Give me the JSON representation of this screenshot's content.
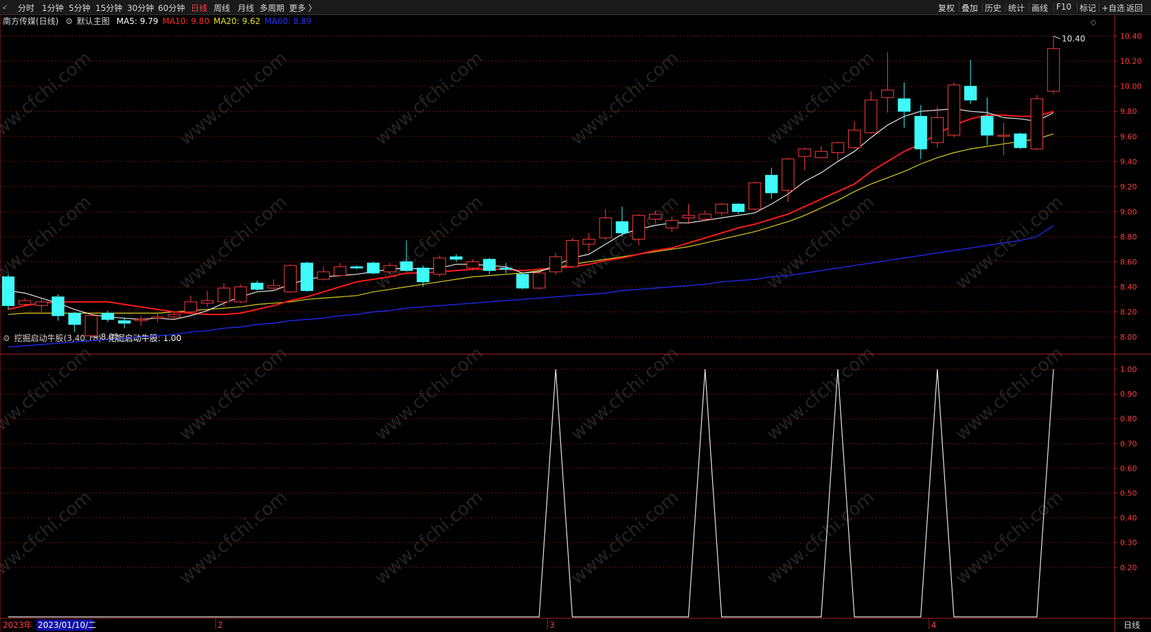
{
  "toolbar": {
    "periods": [
      "分时",
      "1分钟",
      "5分钟",
      "15分钟",
      "30分钟",
      "60分钟",
      "日线",
      "周线",
      "月线",
      "多周期",
      "更多 〉"
    ],
    "active_index": 6,
    "right_buttons": [
      "复权",
      "叠加",
      "历史",
      "统计",
      "画线",
      "F10",
      "标记",
      "+自选",
      "返回"
    ]
  },
  "main_panel": {
    "stock_title": "南方传媒(日线)",
    "template": "默认主图",
    "ma": [
      {
        "label": "MA5: 9.79",
        "color": "#ffffff"
      },
      {
        "label": "MA10: 9.80",
        "color": "#ff2a2a"
      },
      {
        "label": "MA20: 9.62",
        "color": "#e8e020"
      },
      {
        "label": "MA60: 8.89",
        "color": "#2430ff"
      }
    ],
    "high_label": "10.40",
    "low_label": "8.01",
    "y_ticks": [
      "10.40",
      "10.20",
      "10.00",
      "9.80",
      "9.60",
      "9.40",
      "9.20",
      "9.00",
      "8.80",
      "8.60",
      "8.40",
      "8.20",
      "8.00"
    ]
  },
  "indicator_panel": {
    "title": "挖掘启动牛股(3,40,18)",
    "value_label": "挖掘启动牛股: 1.00",
    "y_ticks": [
      "1.00",
      "0.90",
      "0.80",
      "0.70",
      "0.60",
      "0.50",
      "0.40",
      "0.30",
      "0.20"
    ]
  },
  "bottom_bar": {
    "year": "2023年",
    "date": "2023/01/10/二",
    "months": [
      "2",
      "3",
      "4"
    ],
    "period": "日线"
  },
  "watermark": "www.cfchi.com",
  "chart_data": {
    "type": "candlestick",
    "y_range": [
      7.88,
      10.48
    ],
    "candles": [
      {
        "o": 8.48,
        "c": 8.25,
        "h": 8.5,
        "l": 8.22
      },
      {
        "o": 8.26,
        "c": 8.29,
        "h": 8.31,
        "l": 8.25
      },
      {
        "o": 8.25,
        "c": 8.28,
        "h": 8.31,
        "l": 8.2
      },
      {
        "o": 8.32,
        "c": 8.17,
        "h": 8.34,
        "l": 8.13
      },
      {
        "o": 8.19,
        "c": 8.1,
        "h": 8.2,
        "l": 8.04
      },
      {
        "o": 8.01,
        "c": 8.17,
        "h": 8.19,
        "l": 8.0
      },
      {
        "o": 8.19,
        "c": 8.14,
        "h": 8.21,
        "l": 8.12
      },
      {
        "o": 8.13,
        "c": 8.11,
        "h": 8.15,
        "l": 8.07
      },
      {
        "o": 8.13,
        "c": 8.14,
        "h": 8.17,
        "l": 8.09
      },
      {
        "o": 8.15,
        "c": 8.16,
        "h": 8.19,
        "l": 8.12
      },
      {
        "o": 8.16,
        "c": 8.18,
        "h": 8.2,
        "l": 8.14
      },
      {
        "o": 8.2,
        "c": 8.28,
        "h": 8.33,
        "l": 8.18
      },
      {
        "o": 8.27,
        "c": 8.29,
        "h": 8.37,
        "l": 8.24
      },
      {
        "o": 8.28,
        "c": 8.39,
        "h": 8.43,
        "l": 8.24
      },
      {
        "o": 8.28,
        "c": 8.4,
        "h": 8.42,
        "l": 8.27
      },
      {
        "o": 8.43,
        "c": 8.38,
        "h": 8.45,
        "l": 8.37
      },
      {
        "o": 8.39,
        "c": 8.41,
        "h": 8.46,
        "l": 8.37
      },
      {
        "o": 8.36,
        "c": 8.57,
        "h": 8.58,
        "l": 8.35
      },
      {
        "o": 8.59,
        "c": 8.37,
        "h": 8.6,
        "l": 8.36
      },
      {
        "o": 8.46,
        "c": 8.52,
        "h": 8.56,
        "l": 8.45
      },
      {
        "o": 8.49,
        "c": 8.56,
        "h": 8.59,
        "l": 8.48
      },
      {
        "o": 8.56,
        "c": 8.55,
        "h": 8.57,
        "l": 8.54
      },
      {
        "o": 8.59,
        "c": 8.51,
        "h": 8.6,
        "l": 8.5
      },
      {
        "o": 8.52,
        "c": 8.57,
        "h": 8.59,
        "l": 8.5
      },
      {
        "o": 8.6,
        "c": 8.53,
        "h": 8.77,
        "l": 8.52
      },
      {
        "o": 8.55,
        "c": 8.44,
        "h": 8.57,
        "l": 8.4
      },
      {
        "o": 8.5,
        "c": 8.63,
        "h": 8.65,
        "l": 8.48
      },
      {
        "o": 8.64,
        "c": 8.62,
        "h": 8.66,
        "l": 8.6
      },
      {
        "o": 8.55,
        "c": 8.6,
        "h": 8.62,
        "l": 8.53
      },
      {
        "o": 8.62,
        "c": 8.53,
        "h": 8.63,
        "l": 8.5
      },
      {
        "o": 8.55,
        "c": 8.54,
        "h": 8.59,
        "l": 8.51
      },
      {
        "o": 8.5,
        "c": 8.39,
        "h": 8.51,
        "l": 8.38
      },
      {
        "o": 8.39,
        "c": 8.51,
        "h": 8.52,
        "l": 8.38
      },
      {
        "o": 8.52,
        "c": 8.64,
        "h": 8.67,
        "l": 8.5
      },
      {
        "o": 8.56,
        "c": 8.77,
        "h": 8.79,
        "l": 8.55
      },
      {
        "o": 8.74,
        "c": 8.78,
        "h": 8.83,
        "l": 8.68
      },
      {
        "o": 8.79,
        "c": 8.95,
        "h": 9.02,
        "l": 8.77
      },
      {
        "o": 8.92,
        "c": 8.83,
        "h": 9.04,
        "l": 8.8
      },
      {
        "o": 8.78,
        "c": 8.97,
        "h": 8.98,
        "l": 8.73
      },
      {
        "o": 8.94,
        "c": 8.98,
        "h": 9.01,
        "l": 8.91
      },
      {
        "o": 8.87,
        "c": 8.93,
        "h": 8.96,
        "l": 8.84
      },
      {
        "o": 8.95,
        "c": 8.97,
        "h": 9.06,
        "l": 8.9
      },
      {
        "o": 8.94,
        "c": 8.98,
        "h": 9.01,
        "l": 8.92
      },
      {
        "o": 8.99,
        "c": 9.06,
        "h": 9.07,
        "l": 8.96
      },
      {
        "o": 9.06,
        "c": 9.0,
        "h": 9.07,
        "l": 8.98
      },
      {
        "o": 9.02,
        "c": 9.23,
        "h": 9.24,
        "l": 9.01
      },
      {
        "o": 9.29,
        "c": 9.15,
        "h": 9.35,
        "l": 9.1
      },
      {
        "o": 9.17,
        "c": 9.42,
        "h": 9.43,
        "l": 9.08
      },
      {
        "o": 9.44,
        "c": 9.5,
        "h": 9.51,
        "l": 9.33
      },
      {
        "o": 9.43,
        "c": 9.48,
        "h": 9.52,
        "l": 9.43
      },
      {
        "o": 9.47,
        "c": 9.55,
        "h": 9.56,
        "l": 9.41
      },
      {
        "o": 9.51,
        "c": 9.65,
        "h": 9.72,
        "l": 9.5
      },
      {
        "o": 9.63,
        "c": 9.89,
        "h": 9.96,
        "l": 9.62
      },
      {
        "o": 9.91,
        "c": 9.97,
        "h": 10.27,
        "l": 9.79
      },
      {
        "o": 9.9,
        "c": 9.8,
        "h": 10.03,
        "l": 9.67
      },
      {
        "o": 9.76,
        "c": 9.5,
        "h": 9.85,
        "l": 9.42
      },
      {
        "o": 9.55,
        "c": 9.75,
        "h": 9.84,
        "l": 9.51
      },
      {
        "o": 9.61,
        "c": 10.01,
        "h": 10.03,
        "l": 9.59
      },
      {
        "o": 10.0,
        "c": 9.89,
        "h": 10.21,
        "l": 9.86
      },
      {
        "o": 9.76,
        "c": 9.61,
        "h": 9.91,
        "l": 9.53
      },
      {
        "o": 9.6,
        "c": 9.61,
        "h": 9.71,
        "l": 9.45
      },
      {
        "o": 9.62,
        "c": 9.51,
        "h": 9.63,
        "l": 9.5
      },
      {
        "o": 9.5,
        "c": 9.9,
        "h": 9.93,
        "l": 9.49
      },
      {
        "o": 9.96,
        "c": 10.3,
        "h": 10.4,
        "l": 9.94
      }
    ],
    "ma5": [
      8.37,
      8.35,
      8.31,
      8.27,
      8.22,
      8.18,
      8.16,
      8.15,
      8.14,
      8.15,
      8.14,
      8.17,
      8.21,
      8.27,
      8.32,
      8.36,
      8.37,
      8.42,
      8.46,
      8.48,
      8.49,
      8.5,
      8.52,
      8.54,
      8.55,
      8.54,
      8.55,
      8.58,
      8.58,
      8.57,
      8.56,
      8.51,
      8.52,
      8.57,
      8.63,
      8.66,
      8.74,
      8.82,
      8.86,
      8.89,
      8.91,
      8.91,
      8.93,
      8.95,
      8.97,
      8.99,
      9.06,
      9.14,
      9.24,
      9.31,
      9.4,
      9.48,
      9.59,
      9.69,
      9.76,
      9.8,
      9.81,
      9.82,
      9.8,
      9.79,
      9.75,
      9.74,
      9.72,
      9.79
    ],
    "ma10": [
      8.22,
      8.25,
      8.27,
      8.28,
      8.28,
      8.28,
      8.28,
      8.26,
      8.24,
      8.22,
      8.2,
      8.19,
      8.18,
      8.18,
      8.19,
      8.22,
      8.25,
      8.29,
      8.32,
      8.36,
      8.4,
      8.44,
      8.46,
      8.48,
      8.51,
      8.51,
      8.52,
      8.53,
      8.54,
      8.54,
      8.54,
      8.53,
      8.54,
      8.55,
      8.56,
      8.58,
      8.61,
      8.63,
      8.66,
      8.69,
      8.71,
      8.75,
      8.79,
      8.83,
      8.87,
      8.9,
      8.94,
      8.98,
      9.04,
      9.1,
      9.16,
      9.22,
      9.32,
      9.4,
      9.48,
      9.54,
      9.62,
      9.69,
      9.74,
      9.77,
      9.77,
      9.76,
      9.76,
      9.8
    ],
    "ma20": [
      8.18,
      8.19,
      8.19,
      8.19,
      8.19,
      8.19,
      8.19,
      8.19,
      8.19,
      8.19,
      8.2,
      8.21,
      8.22,
      8.23,
      8.24,
      8.26,
      8.27,
      8.28,
      8.3,
      8.31,
      8.32,
      8.33,
      8.36,
      8.38,
      8.4,
      8.42,
      8.44,
      8.46,
      8.48,
      8.49,
      8.5,
      8.51,
      8.53,
      8.55,
      8.58,
      8.6,
      8.62,
      8.64,
      8.66,
      8.68,
      8.7,
      8.72,
      8.75,
      8.78,
      8.81,
      8.84,
      8.88,
      8.92,
      8.97,
      9.03,
      9.09,
      9.16,
      9.22,
      9.27,
      9.32,
      9.38,
      9.43,
      9.47,
      9.5,
      9.52,
      9.54,
      9.56,
      9.58,
      9.62
    ],
    "ma60": [
      7.92,
      7.93,
      7.94,
      7.95,
      7.96,
      7.97,
      7.98,
      7.99,
      8.0,
      8.01,
      8.02,
      8.04,
      8.05,
      8.07,
      8.08,
      8.1,
      8.11,
      8.13,
      8.14,
      8.15,
      8.17,
      8.18,
      8.2,
      8.21,
      8.23,
      8.24,
      8.25,
      8.26,
      8.27,
      8.28,
      8.29,
      8.3,
      8.31,
      8.32,
      8.33,
      8.34,
      8.35,
      8.37,
      8.38,
      8.39,
      8.4,
      8.41,
      8.42,
      8.44,
      8.45,
      8.46,
      8.48,
      8.49,
      8.51,
      8.53,
      8.55,
      8.57,
      8.59,
      8.61,
      8.63,
      8.65,
      8.67,
      8.69,
      8.71,
      8.73,
      8.75,
      8.77,
      8.8,
      8.89
    ],
    "indicator": {
      "name": "挖掘启动牛股",
      "y_range": [
        0,
        1.05
      ],
      "signal_indices": [
        33,
        42,
        50,
        56,
        63
      ],
      "values_nonzero": 1.0
    },
    "x_months": [
      "2",
      "3",
      "4"
    ],
    "month_start_indices": [
      13,
      33,
      56
    ]
  }
}
